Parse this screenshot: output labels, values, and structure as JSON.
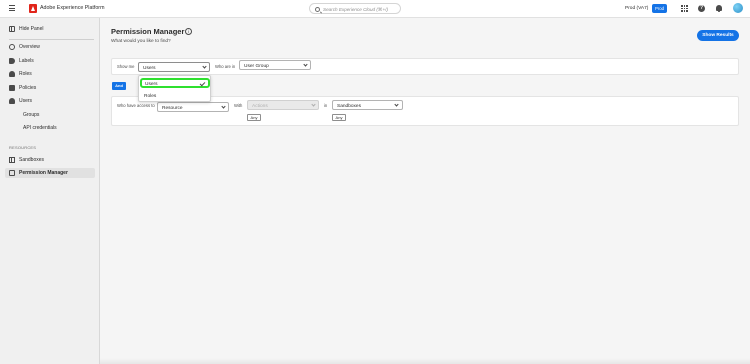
{
  "topbar": {
    "app_title": "Adobe Experience Platform",
    "search_placeholder": "Search Experience Cloud (⌘+/)",
    "org": "Prod (VA7)",
    "env_badge": "Prod"
  },
  "sidebar": {
    "hide_panel": "Hide Panel",
    "items": [
      {
        "label": "Overview",
        "icon": "overview-icon"
      },
      {
        "label": "Labels",
        "icon": "label-icon"
      },
      {
        "label": "Roles",
        "icon": "roles-icon"
      },
      {
        "label": "Policies",
        "icon": "policies-icon"
      },
      {
        "label": "Users",
        "icon": "users-icon"
      },
      {
        "label": "Groups"
      },
      {
        "label": "API credentials"
      }
    ],
    "section_label": "RESOURCES",
    "resource_items": [
      {
        "label": "Sandboxes",
        "icon": "sandbox-icon"
      },
      {
        "label": "Permission Manager",
        "icon": "permission-icon"
      }
    ]
  },
  "main": {
    "title": "Permission Manager",
    "subtitle": "What would you like to find?",
    "show_results": "Show Results",
    "row1": {
      "show_me_label": "Show me",
      "show_me_value": "Users",
      "who_are_in_label": "Who are in",
      "who_are_in_value": "User Group"
    },
    "and_label": "And",
    "row2": {
      "access_label": "Who have access to",
      "resource_value": "Resource",
      "with_label": "With",
      "actions_value": "Actions",
      "in_label": "in",
      "sandboxes_value": "Sandboxes",
      "any_label": "Any"
    },
    "dropdown": {
      "options": [
        "Users",
        "Roles"
      ],
      "selected": "Users"
    }
  },
  "colors": {
    "accent": "#1473e6",
    "highlight": "#2fe02f",
    "brand": "#e1251b"
  }
}
